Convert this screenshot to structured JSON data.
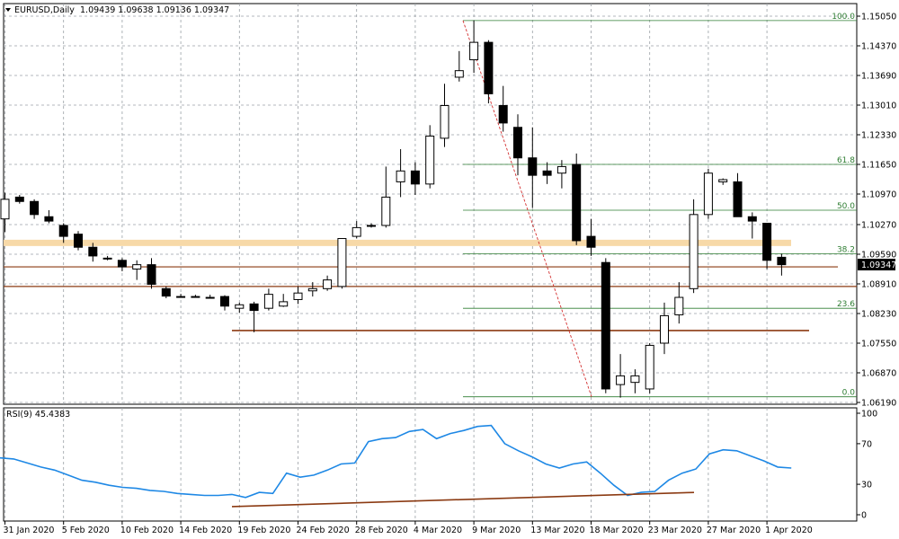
{
  "main_panel": {
    "symbol_label": "EURUSD,Daily",
    "ohlc_text": "1.09439 1.09638 1.09136 1.09347",
    "current_price": "1.09347"
  },
  "indicator_panel": {
    "label": "RSI(9) 45.4383"
  },
  "chart_data": [
    {
      "type": "candlestick",
      "title": "EURUSD,Daily",
      "ylim": [
        1.0619,
        1.1505
      ],
      "y_ticks": [
        1.1505,
        1.1437,
        1.1369,
        1.1301,
        1.1233,
        1.1165,
        1.1097,
        1.1027,
        1.0959,
        1.0891,
        1.0823,
        1.0755,
        1.0687,
        1.0619
      ],
      "y_tick_labels": [
        "1.15050",
        "1.14370",
        "1.13690",
        "1.13010",
        "1.12330",
        "1.11650",
        "1.10970",
        "1.10270",
        "1.09590",
        "1.08910",
        "1.08230",
        "1.07550",
        "1.06870",
        "1.06190"
      ],
      "x_tick_labels": [
        "31 Jan 2020",
        "5 Feb 2020",
        "10 Feb 2020",
        "14 Feb 2020",
        "19 Feb 2020",
        "24 Feb 2020",
        "28 Feb 2020",
        "4 Mar 2020",
        "9 Mar 2020",
        "13 Mar 2020",
        "18 Mar 2020",
        "23 Mar 2020",
        "27 Mar 2020",
        "1 Apr 2020"
      ],
      "x_tick_index": [
        0,
        4,
        8,
        12,
        16,
        20,
        24,
        28,
        32,
        36,
        40,
        44,
        48,
        52
      ],
      "candles": [
        [
          1.104,
          1.11,
          1.101,
          1.1085
        ],
        [
          1.109,
          1.1095,
          1.1075,
          1.108
        ],
        [
          1.108,
          1.1085,
          1.104,
          1.105
        ],
        [
          1.1045,
          1.106,
          1.103,
          1.1035
        ],
        [
          1.1025,
          1.103,
          1.0985,
          1.1
        ],
        [
          1.1005,
          1.1012,
          1.0968,
          1.0975
        ],
        [
          1.0975,
          1.0985,
          1.0942,
          1.0955
        ],
        [
          1.095,
          1.0955,
          1.0945,
          1.095
        ],
        [
          1.0945,
          1.095,
          1.092,
          1.093
        ],
        [
          1.0925,
          1.0945,
          1.09,
          1.0935
        ],
        [
          1.0935,
          1.095,
          1.088,
          1.089
        ],
        [
          1.088,
          1.0885,
          1.0858,
          1.0863
        ],
        [
          1.0862,
          1.0868,
          1.086,
          1.0862
        ],
        [
          1.0862,
          1.0866,
          1.086,
          1.0862
        ],
        [
          1.086,
          1.0866,
          1.0858,
          1.086
        ],
        [
          1.0862,
          1.0865,
          1.083,
          1.084
        ],
        [
          1.0835,
          1.0848,
          1.0825,
          1.0843
        ],
        [
          1.0845,
          1.085,
          1.078,
          1.083
        ],
        [
          1.0835,
          1.088,
          1.083,
          1.0867
        ],
        [
          1.084,
          1.0868,
          1.0838,
          1.085
        ],
        [
          1.0855,
          1.0885,
          1.0845,
          1.087
        ],
        [
          1.0875,
          1.0895,
          1.0862,
          1.088
        ],
        [
          1.088,
          1.091,
          1.0875,
          1.09
        ],
        [
          1.0885,
          1.0995,
          1.088,
          1.0995
        ],
        [
          1.1,
          1.1035,
          1.0995,
          1.102
        ],
        [
          1.1025,
          1.103,
          1.102,
          1.1025
        ],
        [
          1.1025,
          1.116,
          1.102,
          1.109
        ],
        [
          1.1125,
          1.12,
          1.109,
          1.115
        ],
        [
          1.115,
          1.117,
          1.1095,
          1.112
        ],
        [
          1.112,
          1.1255,
          1.111,
          1.123
        ],
        [
          1.1225,
          1.135,
          1.1205,
          1.13
        ],
        [
          1.1365,
          1.1425,
          1.1355,
          1.138
        ],
        [
          1.1405,
          1.1495,
          1.1375,
          1.1445
        ],
        [
          1.1445,
          1.145,
          1.1305,
          1.1327
        ],
        [
          1.13,
          1.1345,
          1.124,
          1.126
        ],
        [
          1.125,
          1.128,
          1.114,
          1.118
        ],
        [
          1.118,
          1.125,
          1.1065,
          1.114
        ],
        [
          1.115,
          1.117,
          1.112,
          1.114
        ],
        [
          1.1145,
          1.1175,
          1.111,
          1.116
        ],
        [
          1.1165,
          1.119,
          1.098,
          1.099
        ],
        [
          1.1,
          1.104,
          1.0955,
          1.0975
        ],
        [
          1.094,
          1.095,
          1.064,
          1.065
        ],
        [
          1.066,
          1.073,
          1.063,
          1.068
        ],
        [
          1.0665,
          1.0695,
          1.064,
          1.068
        ],
        [
          1.065,
          1.0755,
          1.064,
          1.075
        ],
        [
          1.0755,
          1.0848,
          1.073,
          1.0818
        ],
        [
          1.082,
          1.0895,
          1.08,
          1.086
        ],
        [
          1.088,
          1.1085,
          1.087,
          1.105
        ],
        [
          1.105,
          1.1155,
          1.104,
          1.1145
        ],
        [
          1.1125,
          1.1133,
          1.1118,
          1.113
        ],
        [
          1.1125,
          1.1145,
          1.1045,
          1.1045
        ],
        [
          1.1045,
          1.1055,
          1.0995,
          1.1035
        ],
        [
          1.103,
          1.103,
          1.0925,
          1.0945
        ],
        [
          1.0952,
          1.096,
          1.091,
          1.0935
        ]
      ],
      "horizontal_levels": [
        1.0985,
        1.093,
        1.0885,
        1.0784
      ],
      "fibonacci": {
        "levels": [
          "100.0",
          "61.8",
          "50.0",
          "38.2",
          "23.6",
          "0.0"
        ],
        "prices": [
          1.1495,
          1.1165,
          1.106,
          1.096,
          1.0835,
          1.0632
        ]
      }
    },
    {
      "type": "line",
      "title": "RSI(9) 45.4383",
      "ylim": [
        0,
        100
      ],
      "y_ticks": [
        100,
        70,
        30,
        0
      ],
      "y_tick_labels": [
        "100",
        "70",
        "30",
        "0"
      ],
      "series": [
        {
          "values": [
            56,
            55,
            51,
            47,
            44,
            39,
            34,
            32,
            29,
            27,
            26,
            24,
            23,
            21,
            20,
            19,
            19,
            20,
            17,
            22,
            21,
            41,
            37,
            39,
            44,
            50,
            51,
            72,
            75,
            76,
            82,
            84,
            75,
            80,
            83,
            87,
            88,
            70,
            63,
            57,
            50,
            46,
            50,
            52,
            41,
            29,
            19,
            22,
            23,
            34,
            41,
            45,
            60,
            64,
            63,
            58,
            53,
            47,
            46
          ]
        }
      ],
      "trendline_values": [
        8,
        22
      ]
    }
  ]
}
